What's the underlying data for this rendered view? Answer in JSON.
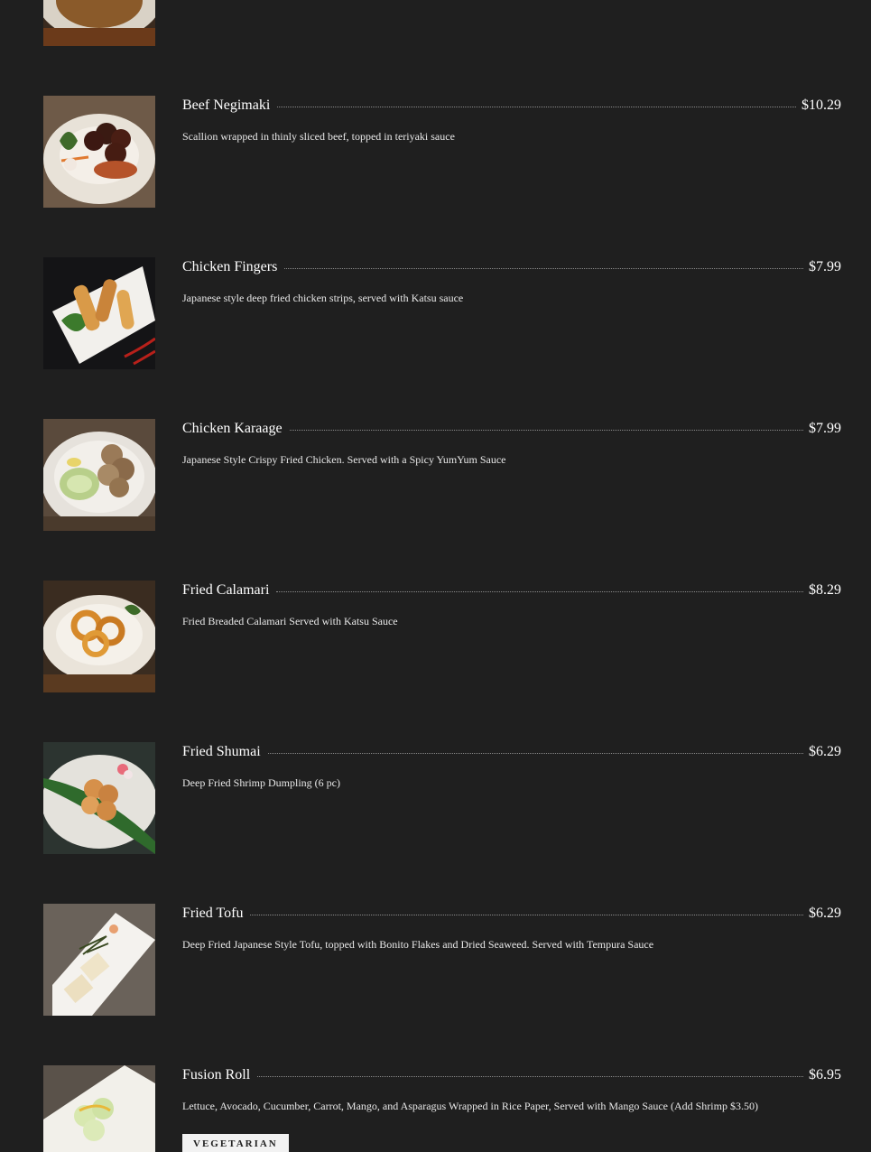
{
  "items": [
    {
      "name": "",
      "price": "",
      "description": "",
      "image": "partial-dish-photo"
    },
    {
      "name": "Beef Negimaki",
      "price": "$10.29",
      "description": "Scallion wrapped in thinly sliced beef, topped in teriyaki sauce",
      "image": "beef-negimaki-photo"
    },
    {
      "name": "Chicken Fingers",
      "price": "$7.99",
      "description": "Japanese style deep fried chicken strips, served with Katsu sauce",
      "image": "chicken-fingers-photo"
    },
    {
      "name": "Chicken Karaage",
      "price": "$7.99",
      "description": "Japanese Style Crispy Fried Chicken. Served with a Spicy YumYum Sauce",
      "image": "chicken-karaage-photo"
    },
    {
      "name": "Fried Calamari",
      "price": "$8.29",
      "description": "Fried Breaded Calamari Served with Katsu Sauce",
      "image": "fried-calamari-photo"
    },
    {
      "name": "Fried Shumai",
      "price": "$6.29",
      "description": "Deep Fried Shrimp Dumpling (6 pc)",
      "image": "fried-shumai-photo"
    },
    {
      "name": "Fried Tofu",
      "price": "$6.29",
      "description": "Deep Fried Japanese Style Tofu, topped with Bonito Flakes and Dried Seaweed. Served with Tempura Sauce",
      "image": "fried-tofu-photo"
    },
    {
      "name": "Fusion Roll",
      "price": "$6.95",
      "description": "Lettuce, Avocado, Cucumber, Carrot, Mango, and Asparagus Wrapped in Rice Paper, Served with Mango Sauce (Add Shrimp $3.50)",
      "image": "fusion-roll-photo",
      "badge": "VEGETARIAN"
    }
  ],
  "colors": {
    "background": "#1f1f1f",
    "text": "#ffffff",
    "badge_bg": "#f2f2f2",
    "badge_text": "#222222"
  }
}
